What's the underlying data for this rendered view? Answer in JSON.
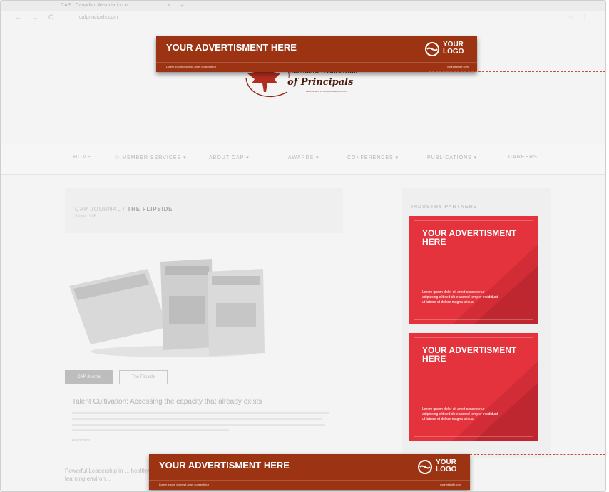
{
  "browser": {
    "tab_title": "CAP · Canadian Association o...",
    "tab_close": "×",
    "new_tab": "+",
    "url": "cafprincipals.com",
    "nav_buttons": "← → C",
    "toolbar_icons": "☆ ⋮"
  },
  "site": {
    "logo": {
      "line1": "Canadian Association",
      "line2": "of Principals",
      "tagline": "LEADERSHIP IN CANADIAN EDUCATION"
    },
    "nav": [
      "HOME",
      "MEMBER SERVICES",
      "ABOUT CAP",
      "AWARDS",
      "CONFERENCES",
      "PUBLICATIONS",
      "CAREERS"
    ],
    "journal": {
      "crumb": "CAP JOURNAL / ",
      "crumb_strong": "THE FLIPSIDE",
      "sub": "Since 1996"
    },
    "buttons": {
      "cap_journal": "CAP Journal",
      "flipside": "The Flipside"
    },
    "article": {
      "title": "Talent Cultivation: Accessing the capacity that already exists",
      "read_more": "Read more"
    },
    "article2": "Powerful Leadership in ... healthy learning environ...",
    "sidebar_title": "INDUSTRY PARTNERS"
  },
  "ads": {
    "side": [
      {
        "title": "YOUR ADVERTISMENT HERE",
        "text": "Lorem ipsum dolor sit amet consectetur adipiscing elit sed do eiusmod tempor incididunt ut labore et dolore magna aliqua"
      },
      {
        "title": "YOUR ADVERTISMENT HERE",
        "text": "Lorem ipsum dolor sit amet consectetur adipiscing elit sed do eiusmod tempor incididunt ut labore et dolore magna aliqua"
      }
    ],
    "top_banner": {
      "title": "YOUR ADVERTISMENT HERE",
      "sub": "Lorem ipsum dolor sit amet consectetur",
      "logo_line1": "YOUR",
      "logo_line2": "LOGO",
      "url": "yourwebsite.com"
    },
    "bottom_banner": {
      "title": "YOUR ADVERTISMENT HERE",
      "sub": "Lorem ipsum dolor sit amet consectetur",
      "logo_line1": "YOUR",
      "logo_line2": "LOGO",
      "url": "yourwebsite.com"
    }
  },
  "colors": {
    "banner": "#9c3414",
    "side_ad": "#e4333c",
    "leader": "#c8503a",
    "logo_red": "#b32d1e"
  }
}
